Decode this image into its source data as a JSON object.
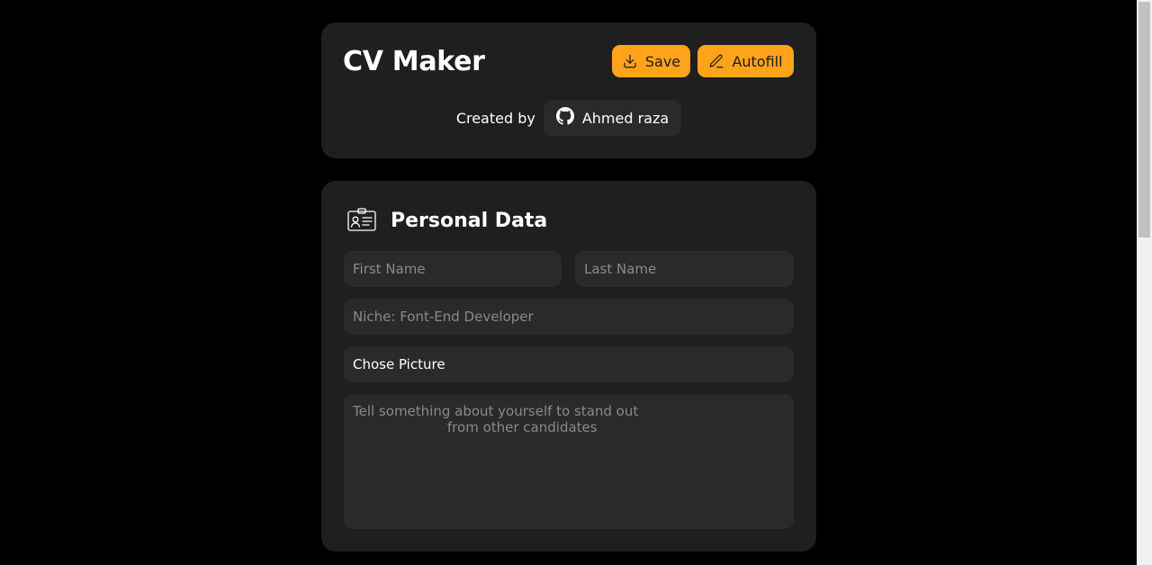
{
  "header": {
    "title": "CV Maker",
    "save_label": "Save",
    "autofill_label": "Autofill",
    "credit_label": "Created by",
    "author_name": "Ahmed raza"
  },
  "personal": {
    "section_title": "Personal Data",
    "first_name_placeholder": "First Name",
    "last_name_placeholder": "Last Name",
    "niche_placeholder": "Niche: Font-End Developer",
    "picture_label": "Chose Picture",
    "about_placeholder": "Tell something about yourself to stand out\n                      from other candidates"
  },
  "colors": {
    "background": "#000000",
    "card": "#1f1f1f",
    "field": "#2a2a2a",
    "accent": "#ffa31a"
  },
  "icons": {
    "save": "download-icon",
    "autofill": "pencil-icon",
    "author": "github-icon",
    "section": "id-card-icon"
  }
}
